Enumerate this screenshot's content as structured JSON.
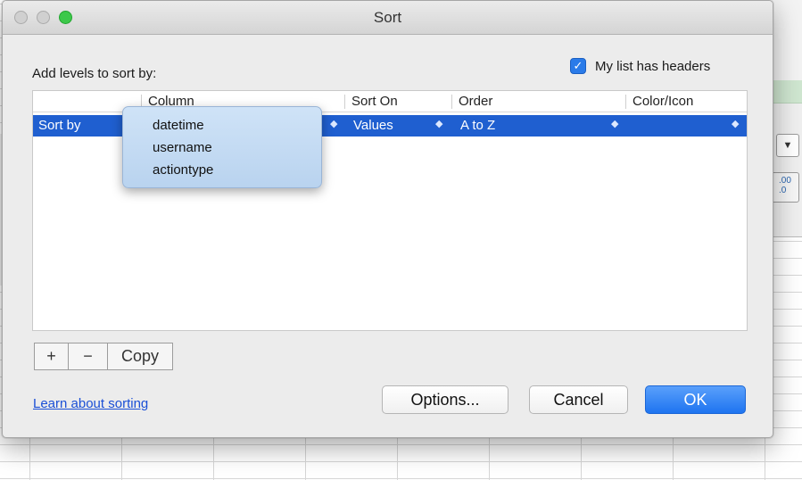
{
  "dialog": {
    "title": "Sort",
    "add_levels_label": "Add levels to sort by:",
    "has_headers_label": "My list has headers",
    "has_headers_checked": true
  },
  "table": {
    "headers": [
      "Column",
      "Sort On",
      "Order",
      "Color/Icon"
    ],
    "row": {
      "label": "Sort by",
      "sort_on": "Values",
      "order": "A to Z"
    }
  },
  "column_menu": {
    "options": [
      "datetime",
      "username",
      "actiontype"
    ]
  },
  "level_buttons": {
    "add": "+",
    "remove": "−",
    "copy": "Copy"
  },
  "footer": {
    "learn_link": "Learn about sorting",
    "options_button": "Options...",
    "cancel_button": "Cancel",
    "ok_button": "OK"
  },
  "background": {
    "decimal_button": ".00\n.0",
    "dropdown_arrow": "▼"
  },
  "colors": {
    "selection": "#1f5fd0",
    "accent": "#2a7be9",
    "ok_button": "#1e74f0",
    "link": "#1a4fd6"
  }
}
